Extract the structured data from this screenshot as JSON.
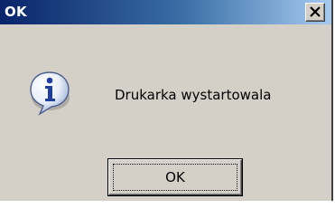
{
  "dialog": {
    "title": "OK",
    "message": "Drukarka wystartowala",
    "ok_label": "OK",
    "icon": "info-icon",
    "close_icon": "close-icon"
  },
  "colors": {
    "titlebar_start": "#0a246a",
    "titlebar_end": "#a6caf0",
    "dialog_face": "#d4d0c8"
  }
}
